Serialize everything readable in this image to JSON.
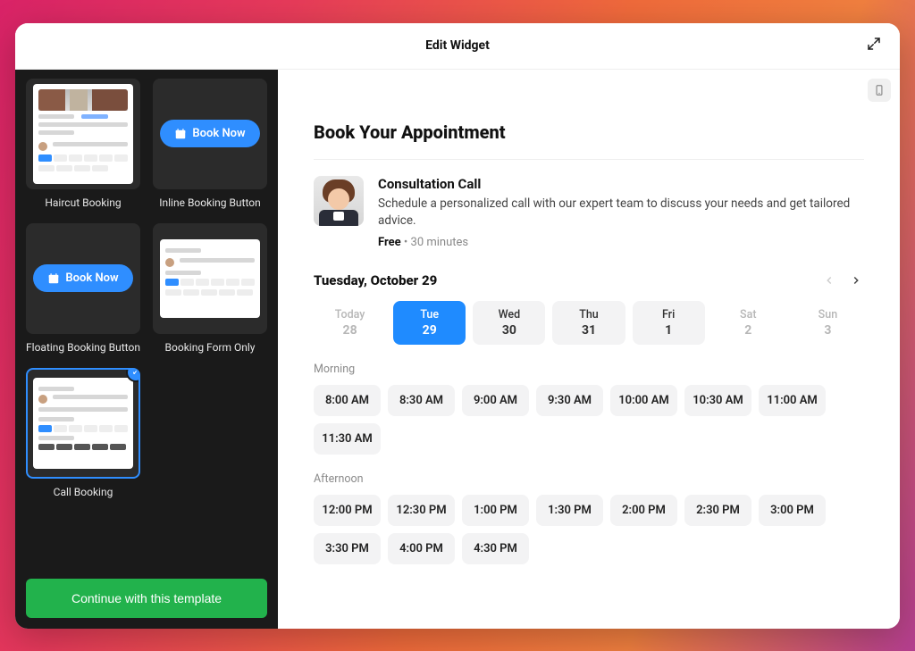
{
  "header": {
    "title": "Edit Widget"
  },
  "sidebar": {
    "templates": [
      {
        "id": "haircut",
        "label": "Haircut Booking"
      },
      {
        "id": "inline",
        "label": "Inline Booking Button",
        "pill_label": "Book Now"
      },
      {
        "id": "floating",
        "label": "Floating Booking Button",
        "pill_label": "Book Now"
      },
      {
        "id": "formonly",
        "label": "Booking Form Only"
      },
      {
        "id": "callbooking",
        "label": "Call Booking"
      }
    ],
    "selected_id": "callbooking",
    "continue_label": "Continue with this template"
  },
  "preview": {
    "heading": "Book Your Appointment",
    "service": {
      "title": "Consultation Call",
      "description": "Schedule a personalized call with our expert team to discuss your needs and get tailored advice.",
      "price": "Free",
      "separator": "•",
      "duration": "30 minutes"
    },
    "date_label": "Tuesday, October 29",
    "days": [
      {
        "dow": "Today",
        "dom": "28",
        "state": "disabled"
      },
      {
        "dow": "Tue",
        "dom": "29",
        "state": "selected"
      },
      {
        "dow": "Wed",
        "dom": "30",
        "state": "normal"
      },
      {
        "dow": "Thu",
        "dom": "31",
        "state": "normal"
      },
      {
        "dow": "Fri",
        "dom": "1",
        "state": "normal"
      },
      {
        "dow": "Sat",
        "dom": "2",
        "state": "disabled"
      },
      {
        "dow": "Sun",
        "dom": "3",
        "state": "disabled"
      }
    ],
    "sections": [
      {
        "label": "Morning",
        "slots": [
          "8:00 AM",
          "8:30 AM",
          "9:00 AM",
          "9:30 AM",
          "10:00 AM",
          "10:30 AM",
          "11:00 AM",
          "11:30 AM"
        ]
      },
      {
        "label": "Afternoon",
        "slots": [
          "12:00 PM",
          "12:30 PM",
          "1:00 PM",
          "1:30 PM",
          "2:00 PM",
          "2:30 PM",
          "3:00 PM",
          "3:30 PM",
          "4:00 PM",
          "4:30 PM"
        ]
      }
    ]
  }
}
